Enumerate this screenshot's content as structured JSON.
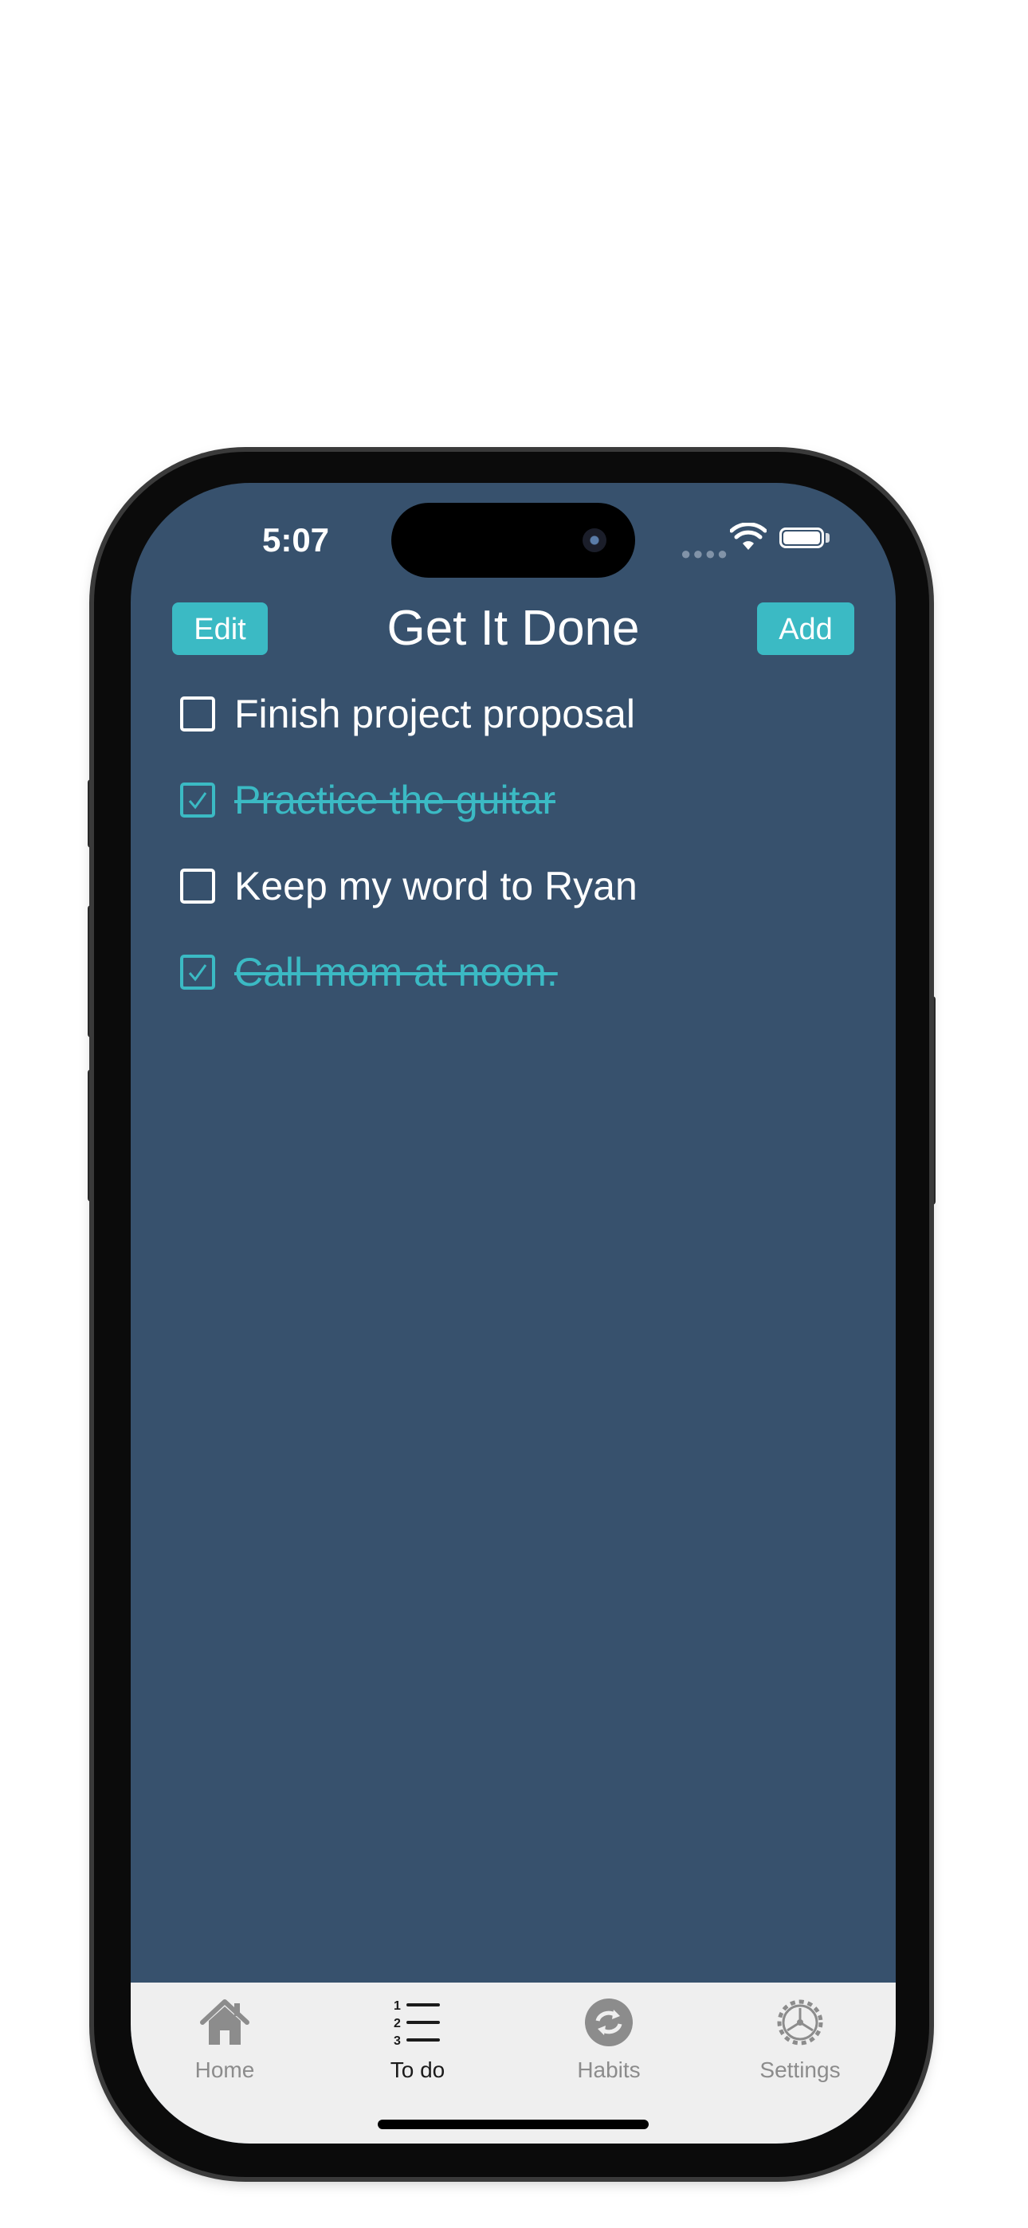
{
  "status_bar": {
    "time": "5:07",
    "signal_icon": "cellular-dots-icon",
    "wifi_icon": "wifi-icon",
    "battery_icon": "battery-full-icon",
    "battery_level": 1.0
  },
  "header": {
    "title": "Get It Done",
    "edit_label": "Edit",
    "add_label": "Add",
    "accent_color": "#3bbac4",
    "background_color": "#37516d"
  },
  "todos": [
    {
      "text": "Finish project proposal",
      "completed": false
    },
    {
      "text": "Practice the guitar",
      "completed": true
    },
    {
      "text": "Keep my word to Ryan",
      "completed": false
    },
    {
      "text": "Call mom at noon.",
      "completed": true
    }
  ],
  "tab_bar": {
    "active": "To do",
    "tabs": [
      {
        "label": "Home",
        "icon": "house-icon"
      },
      {
        "label": "To do",
        "icon": "numbered-list-icon"
      },
      {
        "label": "Habits",
        "icon": "repeat-icon"
      },
      {
        "label": "Settings",
        "icon": "gear-icon"
      }
    ]
  }
}
